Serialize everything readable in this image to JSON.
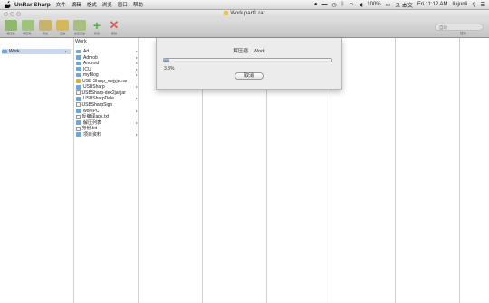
{
  "menubar": {
    "app_name": "UnRar Sharp",
    "menus": [
      "文件",
      "编辑",
      "格式",
      "浏览",
      "窗口",
      "帮助"
    ],
    "status_input": "ス 本文",
    "battery": "100%",
    "clock": "Fri 11:12 AM",
    "user": "liujunli"
  },
  "window": {
    "title": "Work.part1.rar"
  },
  "toolbar": {
    "buttons": [
      {
        "label": "解压缩",
        "color": "#8fb86a"
      },
      {
        "label": "解压到...",
        "color": "#9ec37c"
      },
      {
        "label": "添加",
        "color": "#c9b26a"
      },
      {
        "label": "压缩",
        "color": "#d4b85e"
      },
      {
        "label": "加密压缩",
        "color": "#a7c080"
      },
      {
        "label": "新建",
        "color": "#4cae4c"
      },
      {
        "label": "删除",
        "color": "#d95c5c"
      }
    ],
    "search_value": "自动",
    "search_label": "搜索"
  },
  "browser": {
    "col1": [
      {
        "name": "Work",
        "type": "folder"
      }
    ],
    "col2_header": "Work",
    "col2": [
      {
        "name": "Ad",
        "type": "folder"
      },
      {
        "name": "Admob",
        "type": "folder"
      },
      {
        "name": "Android",
        "type": "folder"
      },
      {
        "name": "ICU",
        "type": "folder"
      },
      {
        "name": "myBlog",
        "type": "folder"
      },
      {
        "name": "USB Sharp_vwjyjw.rar",
        "type": "archive"
      },
      {
        "name": "USBSharp",
        "type": "folder"
      },
      {
        "name": "USBSharp-dex2jar.jar",
        "type": "doc"
      },
      {
        "name": "USBSharpDele",
        "type": "folder"
      },
      {
        "name": "USBSharpSign",
        "type": "doc"
      },
      {
        "name": "workPC",
        "type": "folder"
      },
      {
        "name": "反编译apk.txt",
        "type": "doc"
      },
      {
        "name": "解压列表",
        "type": "folder"
      },
      {
        "name": "身份.txt",
        "type": "doc"
      },
      {
        "name": "项目资料",
        "type": "folder"
      }
    ]
  },
  "progress": {
    "title": "解压缩... Work",
    "percent_text": "3.3%",
    "fraction": 0.033,
    "cancel_label": "取消"
  }
}
